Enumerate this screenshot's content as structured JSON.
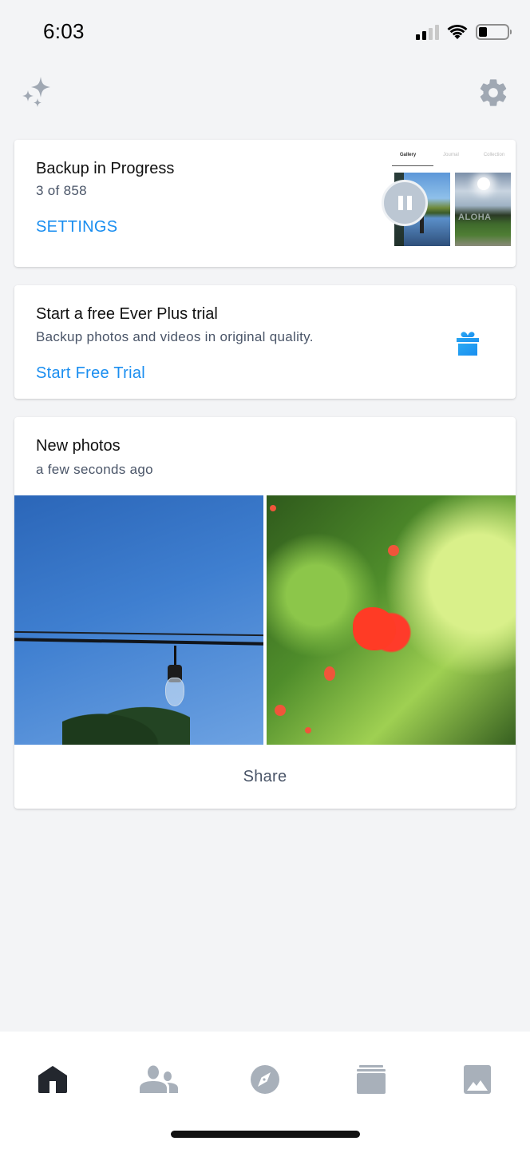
{
  "status_bar": {
    "time": "6:03",
    "signal_bars_active": 2,
    "signal_bars_total": 4,
    "wifi": "wifi-icon",
    "battery_level_fraction": 0.3
  },
  "topbar": {
    "left_icon": "sparkles-icon",
    "right_icon": "gear-icon"
  },
  "backup_card": {
    "title": "Backup in Progress",
    "progress_text": "3 of 858",
    "progress_current": 3,
    "progress_total": 858,
    "settings_label": "SETTINGS",
    "preview_tabs": [
      "Gallery",
      "Journal",
      "Collection"
    ],
    "preview_active_tab": "Gallery",
    "pause_icon": "pause-icon"
  },
  "trial_card": {
    "title": "Start a free Ever Plus trial",
    "subtitle": "Backup photos and videos in original quality.",
    "cta_label": "Start Free Trial",
    "icon": "gift-icon"
  },
  "photos_card": {
    "title": "New photos",
    "timestamp": "a few seconds ago",
    "photos": [
      {
        "description": "String light bulb against blue sky"
      },
      {
        "description": "Red pomegranate flower among green leaves"
      }
    ],
    "share_label": "Share"
  },
  "bottom_nav": {
    "items": [
      {
        "id": "home",
        "icon": "home-icon",
        "active": true
      },
      {
        "id": "people",
        "icon": "people-icon",
        "active": false
      },
      {
        "id": "explore",
        "icon": "compass-icon",
        "active": false
      },
      {
        "id": "albums",
        "icon": "albums-stack-icon",
        "active": false
      },
      {
        "id": "photos",
        "icon": "photo-icon",
        "active": false
      }
    ]
  },
  "colors": {
    "background": "#f3f4f6",
    "accent_blue": "#1a8ef0",
    "icon_gray": "#a0a8b3",
    "active_icon": "#23272e",
    "subtitle": "#4a5568"
  }
}
